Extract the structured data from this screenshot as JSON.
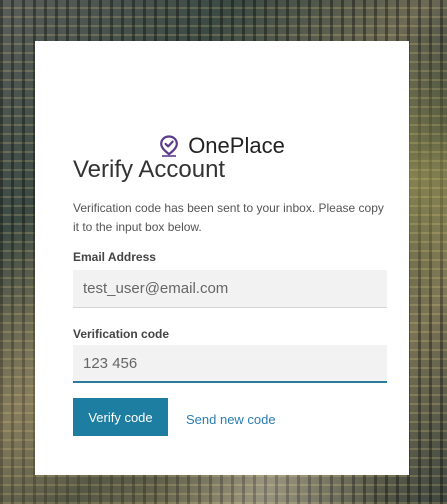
{
  "brand": {
    "name": "OnePlace",
    "icon": "location-pin-check-icon",
    "icon_color": "#5b3b8c"
  },
  "heading": "Verify Account",
  "description": "Verification code has been sent to your inbox. Please copy it to the input box below.",
  "email": {
    "label": "Email Address",
    "value": "test_user@email.com"
  },
  "code": {
    "label": "Verification code",
    "value": "123 456"
  },
  "actions": {
    "verify_label": "Verify code",
    "resend_label": "Send new code"
  },
  "colors": {
    "primary_button": "#1e7ea1",
    "link": "#2a7db2",
    "active_underline": "#2a7a9a"
  }
}
